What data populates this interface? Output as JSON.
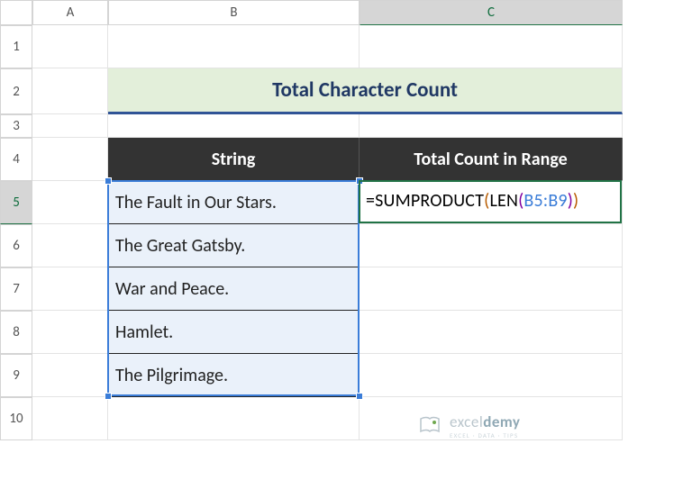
{
  "columns": [
    "A",
    "B",
    "C"
  ],
  "rows": [
    "1",
    "2",
    "3",
    "4",
    "5",
    "6",
    "7",
    "8",
    "9",
    "10"
  ],
  "title": "Total Character Count",
  "headers": {
    "string": "String",
    "count": "Total Count in Range"
  },
  "strings": [
    "The Fault in Our Stars.",
    "The Great Gatsby.",
    "War and Peace.",
    "Hamlet.",
    "The Pilgrimage."
  ],
  "formula": {
    "prefix": "=SUMPRODUCT",
    "open1": "(",
    "fn2": "LEN",
    "open2": "(",
    "ref": "B5:B9",
    "close2": ")",
    "close1": ")"
  },
  "watermark": {
    "name_plain": "excel",
    "name_bold": "demy",
    "tagline": "EXCEL · DATA · TIPS"
  },
  "chart_data": {
    "type": "table",
    "title": "Total Character Count",
    "columns": [
      "String",
      "Total Count in Range"
    ],
    "rows": [
      [
        "The Fault in Our Stars.",
        "=SUMPRODUCT(LEN(B5:B9))"
      ],
      [
        "The Great Gatsby.",
        ""
      ],
      [
        "War and Peace.",
        ""
      ],
      [
        "Hamlet.",
        ""
      ],
      [
        "The Pilgrimage.",
        ""
      ]
    ]
  }
}
